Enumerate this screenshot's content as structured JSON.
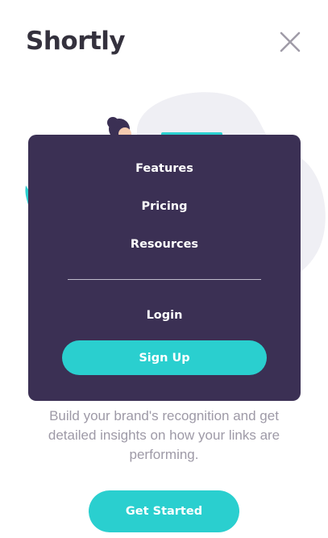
{
  "header": {
    "logo": "Shortly",
    "close_icon": "close-icon"
  },
  "hero": {
    "illustration": "person-working-illustration"
  },
  "menu": {
    "items": [
      {
        "label": "Features"
      },
      {
        "label": "Pricing"
      },
      {
        "label": "Resources"
      }
    ],
    "login_label": "Login",
    "signup_label": "Sign Up"
  },
  "main": {
    "tagline": "Build your brand's recognition and get detailed insights on how your links are performing.",
    "cta_label": "Get Started"
  },
  "colors": {
    "primary": "#2acfcf",
    "menu_bg": "#3b3054",
    "text_dark": "#34313d",
    "text_gray": "#9e9aa7"
  }
}
